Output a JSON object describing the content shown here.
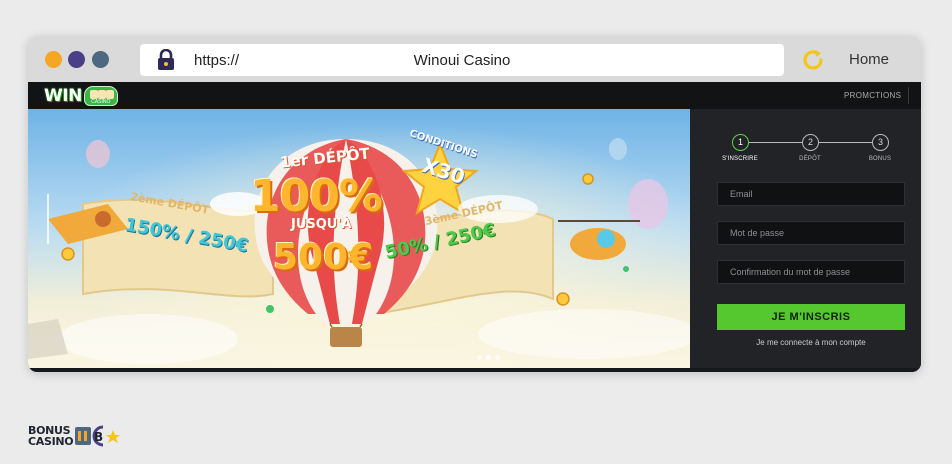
{
  "browser": {
    "scheme": "https://",
    "title": "Winoui Casino",
    "home_label": "Home",
    "icons": [
      "lock-icon",
      "reload-icon"
    ],
    "dot_colors": [
      "#f5a623",
      "#4b3f87",
      "#4f6882"
    ]
  },
  "site": {
    "logo_text": "WIN",
    "logo_sub": "CASINO",
    "nav": {
      "promotions": "PROMCTIONS"
    },
    "hero": {
      "first_deposit": "1er DÉPÔT",
      "first_percent": "100%",
      "up_to": "JUSQU'À",
      "first_amount": "500€",
      "conditions": "CONDITIONS",
      "wager": "X30",
      "second_deposit": "2ème DÉPÔT",
      "second_offer": "150% / 250€",
      "third_deposit": "3ème DÉPÔT",
      "third_offer": "50% / 250€",
      "slides": 3,
      "active_slide": 2
    },
    "signup": {
      "steps": [
        {
          "number": "1",
          "label": "S'INSCRIRE",
          "active": true
        },
        {
          "number": "2",
          "label": "DÉPÔT",
          "active": false
        },
        {
          "number": "3",
          "label": "BONUS",
          "active": false
        }
      ],
      "email_placeholder": "Email",
      "password_placeholder": "Mot de passe",
      "confirm_placeholder": "Confirmation du mot de passe",
      "submit_label": "JE M'INSCRIS",
      "login_link": "Je me connecte à mon compte",
      "accent_color": "#55c82f"
    }
  },
  "watermark": {
    "line1": "BONUS",
    "line2": "CASINO"
  }
}
